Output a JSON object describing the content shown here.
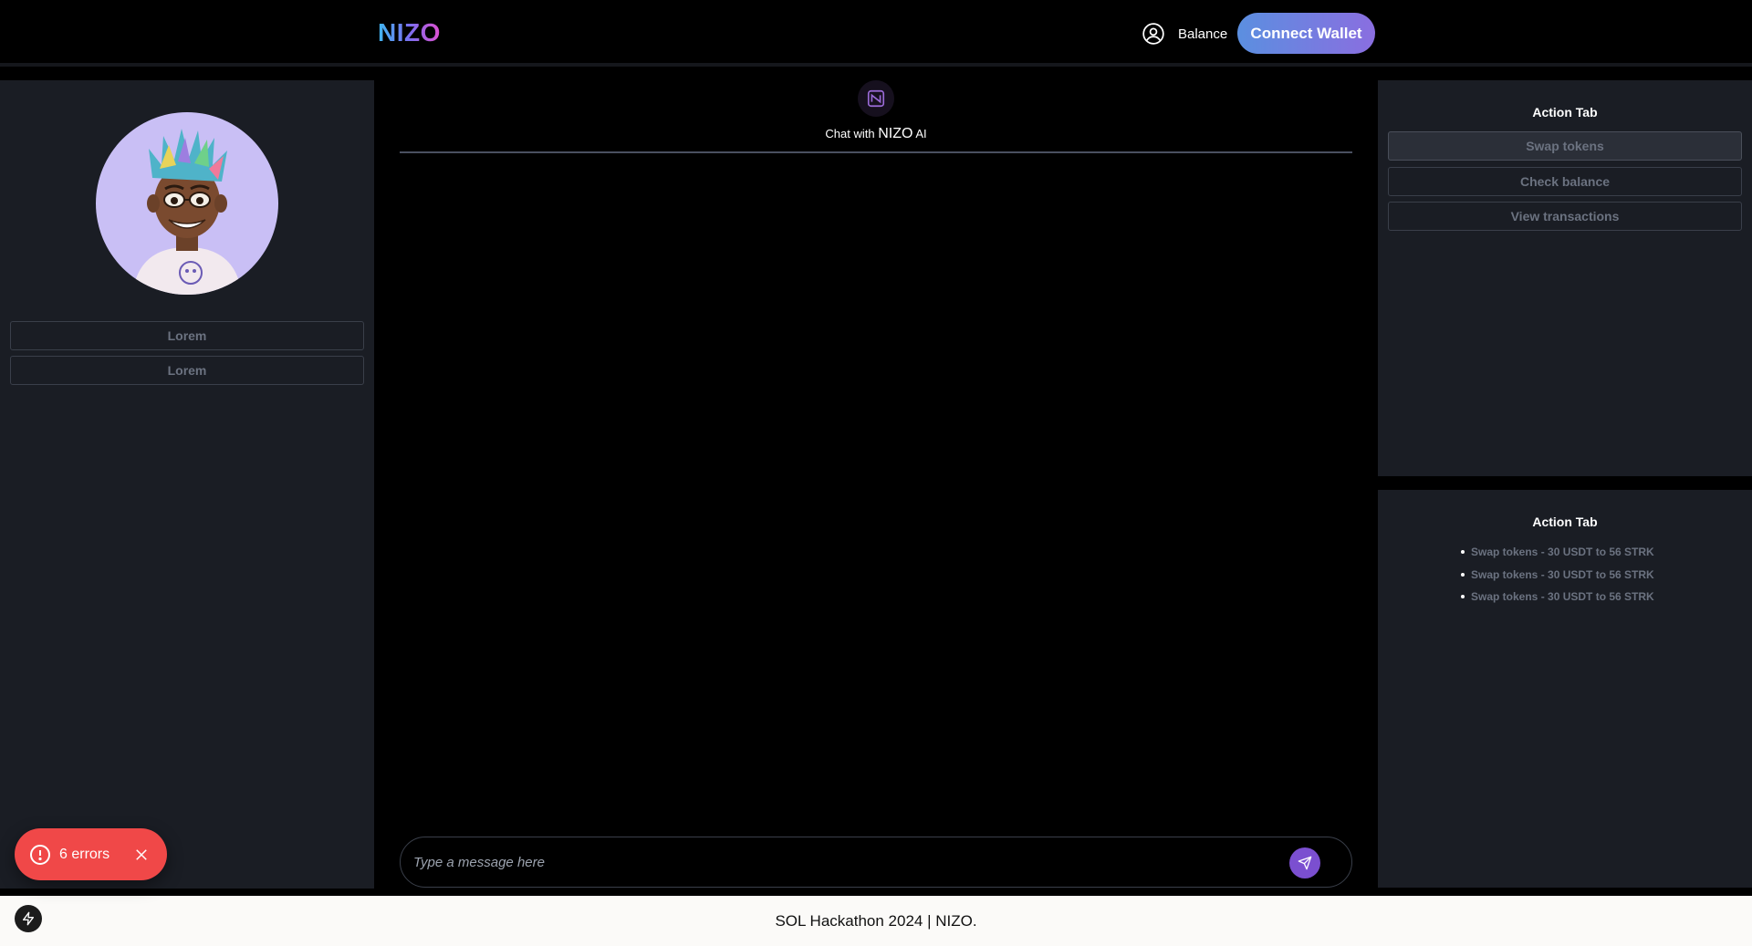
{
  "header": {
    "logo": "NIZO",
    "balance_label": "Balance",
    "connect_wallet_label": "Connect Wallet"
  },
  "left_panel": {
    "buttons": [
      {
        "label": "Lorem"
      },
      {
        "label": "Lorem"
      }
    ]
  },
  "chat": {
    "title_prefix": "Chat with",
    "title_brand": "NIZO",
    "title_suffix": "AI",
    "input_placeholder": "Type a message here"
  },
  "action_panel": {
    "title": "Action Tab",
    "buttons": [
      {
        "label": "Swap tokens",
        "active": true
      },
      {
        "label": "Check balance",
        "active": false
      },
      {
        "label": "View transactions",
        "active": false
      }
    ]
  },
  "history_panel": {
    "title": "Action Tab",
    "items": [
      "Swap tokens - 30 USDT to 56 STRK",
      "Swap tokens - 30 USDT to 56 STRK",
      "Swap tokens - 30 USDT to 56 STRK"
    ]
  },
  "footer": {
    "text": "SOL Hackathon 2024 | NIZO."
  },
  "error_toast": {
    "label": "6 errors"
  },
  "colors": {
    "background": "#000000",
    "panel": "#1a1d24",
    "accent_start": "#5b8fe0",
    "accent_end": "#8a6ee0",
    "error": "#f04848"
  },
  "icons": {
    "balance": "user-circle-icon",
    "send": "send-icon",
    "chat_header": "nizo-ai-icon",
    "error": "alert-circle-icon",
    "close": "close-icon",
    "dev": "lightning-icon"
  }
}
